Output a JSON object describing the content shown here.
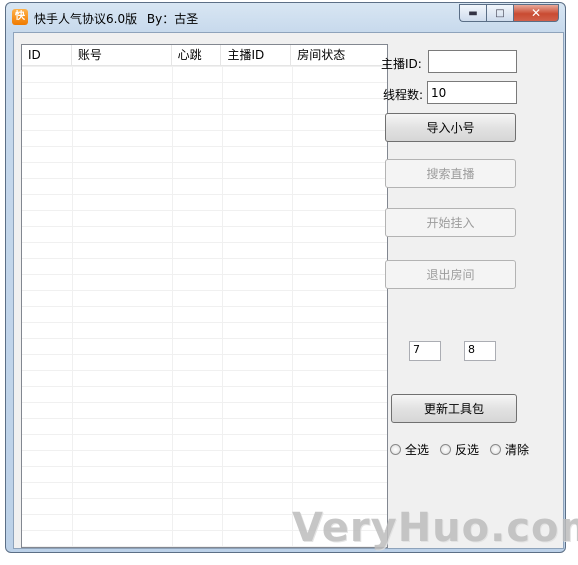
{
  "window": {
    "title": "快手人气协议6.0版",
    "author": "By：古圣",
    "icon_text": "快",
    "controls": {
      "minimize": "minimize-icon",
      "maximize": "maximize-icon",
      "close": "close-icon"
    }
  },
  "table": {
    "columns": [
      "ID",
      "账号",
      "心跳",
      "主播ID",
      "房间状态"
    ],
    "rows": []
  },
  "form": {
    "anchor_id_label": "主播ID:",
    "anchor_id_value": "",
    "threads_label": "线程数:",
    "threads_value": "10"
  },
  "buttons": {
    "import": "导入小号",
    "search": "搜索直播",
    "start": "开始挂入",
    "exit": "退出房间",
    "update": "更新工具包"
  },
  "small_inputs": {
    "a": "7",
    "b": "8"
  },
  "radios": {
    "select_all": "全选",
    "invert": "反选",
    "clear": "清除"
  },
  "watermark": "VeryHuo.com"
}
